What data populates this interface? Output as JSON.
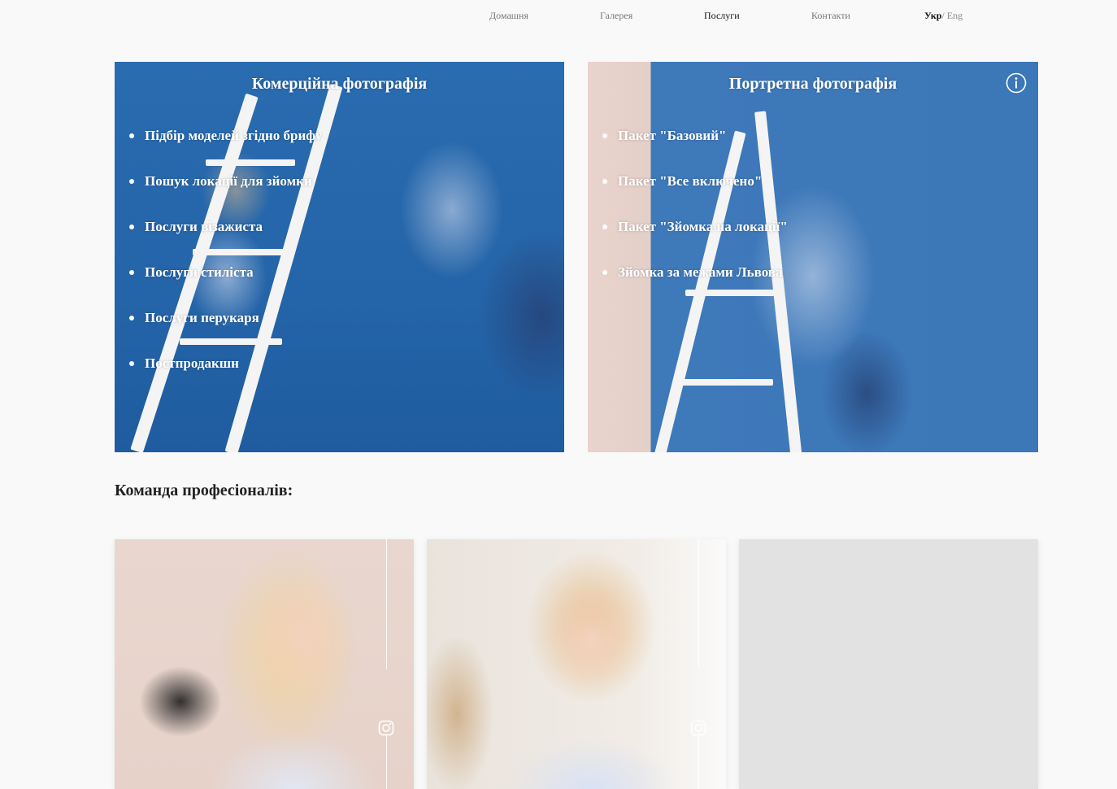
{
  "nav": {
    "items": [
      "Домашня",
      "Галерея",
      "Послуги",
      "Контакти"
    ],
    "active": "Послуги",
    "lang_active": "Укр",
    "lang_separator": "/",
    "lang_other": " Eng"
  },
  "services": [
    {
      "title": "Комерційна фотографія",
      "items": [
        "Підбір моделей згідно брифу",
        "Пошук локації для зйомки",
        "Послуги візажиста",
        "Послуги стиліста",
        "Послуги перукаря",
        "Постпродакшн"
      ]
    },
    {
      "title": "Портретна фотографія",
      "items": [
        "Пакет \"Базовий\"",
        "Пакет \"Все включено\"",
        "Пакет \"Зйомка на локації\"",
        "Зйомка за межами Львова"
      ],
      "icon": "info-icon"
    }
  ],
  "team": {
    "heading": "Команда професіоналів:",
    "members": [
      {
        "icon": "instagram-icon"
      },
      {
        "icon": "instagram-icon"
      },
      {}
    ]
  },
  "colors": {
    "background": "#f9f9f9",
    "card_blue": "#2b6bad",
    "placeholder_gray": "#e2e2e2"
  }
}
